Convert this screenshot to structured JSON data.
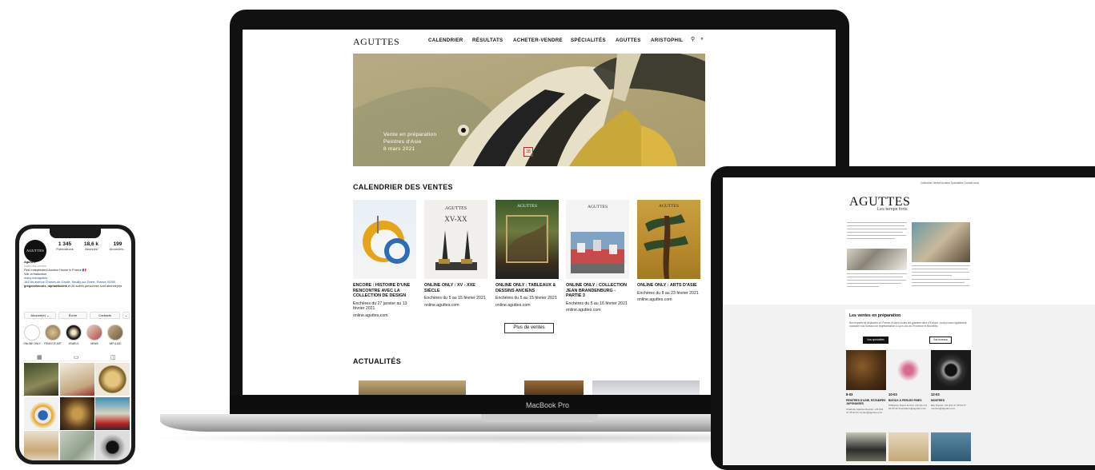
{
  "phone": {
    "avatar_label": "AGUTTES",
    "stats": [
      {
        "value": "1 345",
        "label": "Publications"
      },
      {
        "value": "18,6 k",
        "label": "Abonnés"
      },
      {
        "value": "199",
        "label": "Abonnem..."
      }
    ],
    "bio": {
      "name": "Aguttes",
      "category": "Salle des ventes",
      "line1": "First Independent Auction House in France 🇫🇷",
      "line2": "Voir la traduction",
      "link": "many.link/aguttes",
      "address": "164 bis avenue Charles-de-Gaulle, Neuilly-sur-Seine, France 92200",
      "followers_bold": "gregoirelacroix, raphaelkoznk",
      "followers_rest": " et 26 autres personnes sont abonné(e)s"
    },
    "buttons": [
      "Abonné(e) ⌄",
      "Écrire",
      "Contacts",
      "⌄"
    ],
    "highlights": [
      "ONLINE ONLY",
      "FIEAN OF ART",
      "JEWELS",
      "NEWS",
      "IMP & MO"
    ],
    "tab_icons": [
      "grid-icon",
      "reels-icon",
      "tagged-icon"
    ]
  },
  "laptop": {
    "device_label": "MacBook Pro",
    "logo": "AGUTTES",
    "nav": [
      "CALENDRIER",
      "RÉSULTATS",
      "ACHETER-VENDRE",
      "SPÉCIALITÉS",
      "AGUTTES",
      "ARISTOPHIL"
    ],
    "hero": {
      "line1": "Vente en préparation",
      "line2": "Peintres d'Asie",
      "line3": "8 mars 2021",
      "badge": "28"
    },
    "calendar_title": "CALENDRIER DES VENTES",
    "cards": [
      {
        "title": "ENCORE : HISTOIRE D'UNE RENCONTRE AVEC LA COLLECTION DE DESIGN",
        "dates": "Enchères du 27 janvier au 13 février 2021",
        "url": "online.aguttes.com"
      },
      {
        "title": "ONLINE ONLY : XV - XXE SIÈCLE",
        "dates": "Enchères du 5 au 15 février 2021",
        "url": "online.aguttes.com"
      },
      {
        "title": "ONLINE ONLY : TABLEAUX & DESSINS ANCIENS",
        "dates": "Enchères du 5 au 15 février 2021",
        "url": "online.aguttes.com"
      },
      {
        "title": "ONLINE ONLY : COLLECTION JEAN BRANDENBURG - PARTIE 3",
        "dates": "Enchères du 5 au 16 février 2021",
        "url": "online.aguttes.com"
      },
      {
        "title": "ONLINE ONLY : ARTS D'ASIE",
        "dates": "Enchères du 8 au 23 février 2021",
        "url": "online.aguttes.com"
      }
    ],
    "more_button": "Plus de ventes",
    "news_title": "ACTUALITÉS"
  },
  "tablet": {
    "logo": "AGUTTES",
    "tagline": "Les temps forts",
    "top_nav": "Calendrier   Ventes   Acheter   Spécialités      Contact nous",
    "panel_title": "Les ventes en préparation",
    "panel_text": "Nos experts se déplacent en France et dans toutes les grandes villes d'Europe, vous pouvez également contacter nos bureaux de représentation à Lyon, Aix-en-Provence et Bruxelles.",
    "btn_primary": "Nos spécialités",
    "btn_secondary": "Voir bureaux",
    "lots": [
      {
        "date": "8-03",
        "title": "PEINTRES D'ASIE, ESTAMPES JAPONAISES",
        "text": "Charlotte Aguttes-Reynier +33 (0)1 47 45 93 01 reynier@aguttes.com"
      },
      {
        "date": "10-03",
        "title": "BIJOUX & PERLES FINES",
        "text": "Philippine Dupré la Tour +33 (0)1 41 92 06 42 duprelatour@aguttes.com"
      },
      {
        "date": "12-03",
        "title": "MONTRES",
        "text": "Elie Dupuis +33 (0)1 47 45 93 07 montres@aguttes.com"
      }
    ]
  },
  "colors": {
    "accent_red": "#b8232a",
    "device_black": "#111111"
  }
}
